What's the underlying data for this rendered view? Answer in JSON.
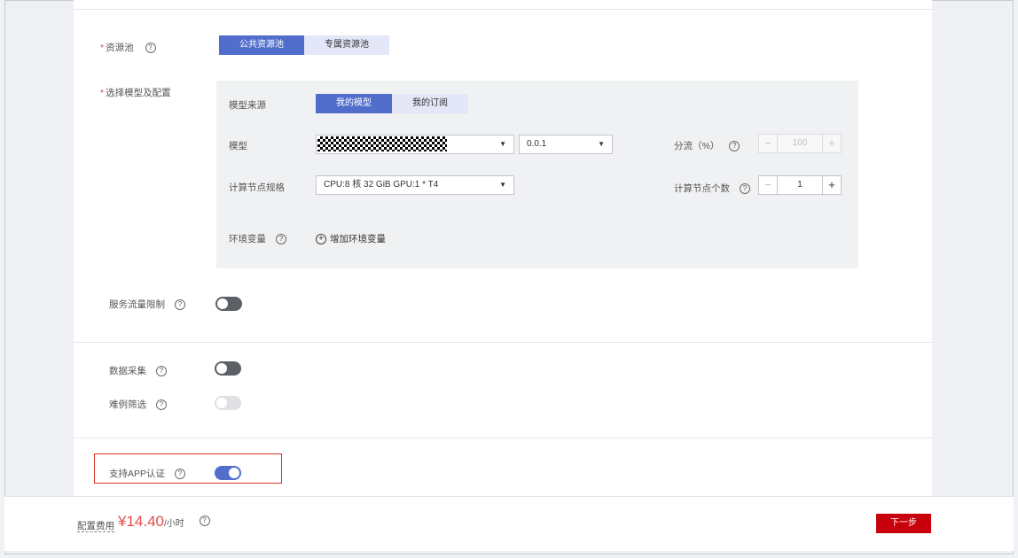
{
  "resource_pool": {
    "label": "资源池",
    "options": [
      "公共资源池",
      "专属资源池"
    ],
    "selected": "公共资源池"
  },
  "model_config": {
    "label": "选择模型及配置",
    "source_label": "模型来源",
    "source_options": [
      "我的模型",
      "我的订阅"
    ],
    "source_selected": "我的模型",
    "model_label": "模型",
    "version_value": "0.0.1",
    "traffic_label": "分流（%）",
    "traffic_value": "100",
    "spec_label": "计算节点规格",
    "spec_value": "CPU:8 核 32 GiB GPU:1 * T4",
    "node_count_label": "计算节点个数",
    "node_count_value": "1",
    "env_label": "环境变量",
    "add_env_label": "增加环境变量"
  },
  "traffic_limit": {
    "label": "服务流量限制",
    "enabled": false
  },
  "data_collection": {
    "label": "数据采集",
    "enabled": false
  },
  "hard_example": {
    "label": "难例筛选",
    "enabled": false,
    "disabled": true
  },
  "app_auth": {
    "label": "支持APP认证",
    "enabled": true
  },
  "footer": {
    "cost_label": "配置费用",
    "cost_value": "¥14.40",
    "cost_unit": "/小时",
    "next_label": "下一步"
  },
  "symbols": {
    "help": "?",
    "caret": "▼",
    "minus": "−",
    "plus": "+",
    "required": "*"
  },
  "colors": {
    "accent": "#526ecc",
    "danger": "#c7000b",
    "price": "#e64c4c"
  }
}
